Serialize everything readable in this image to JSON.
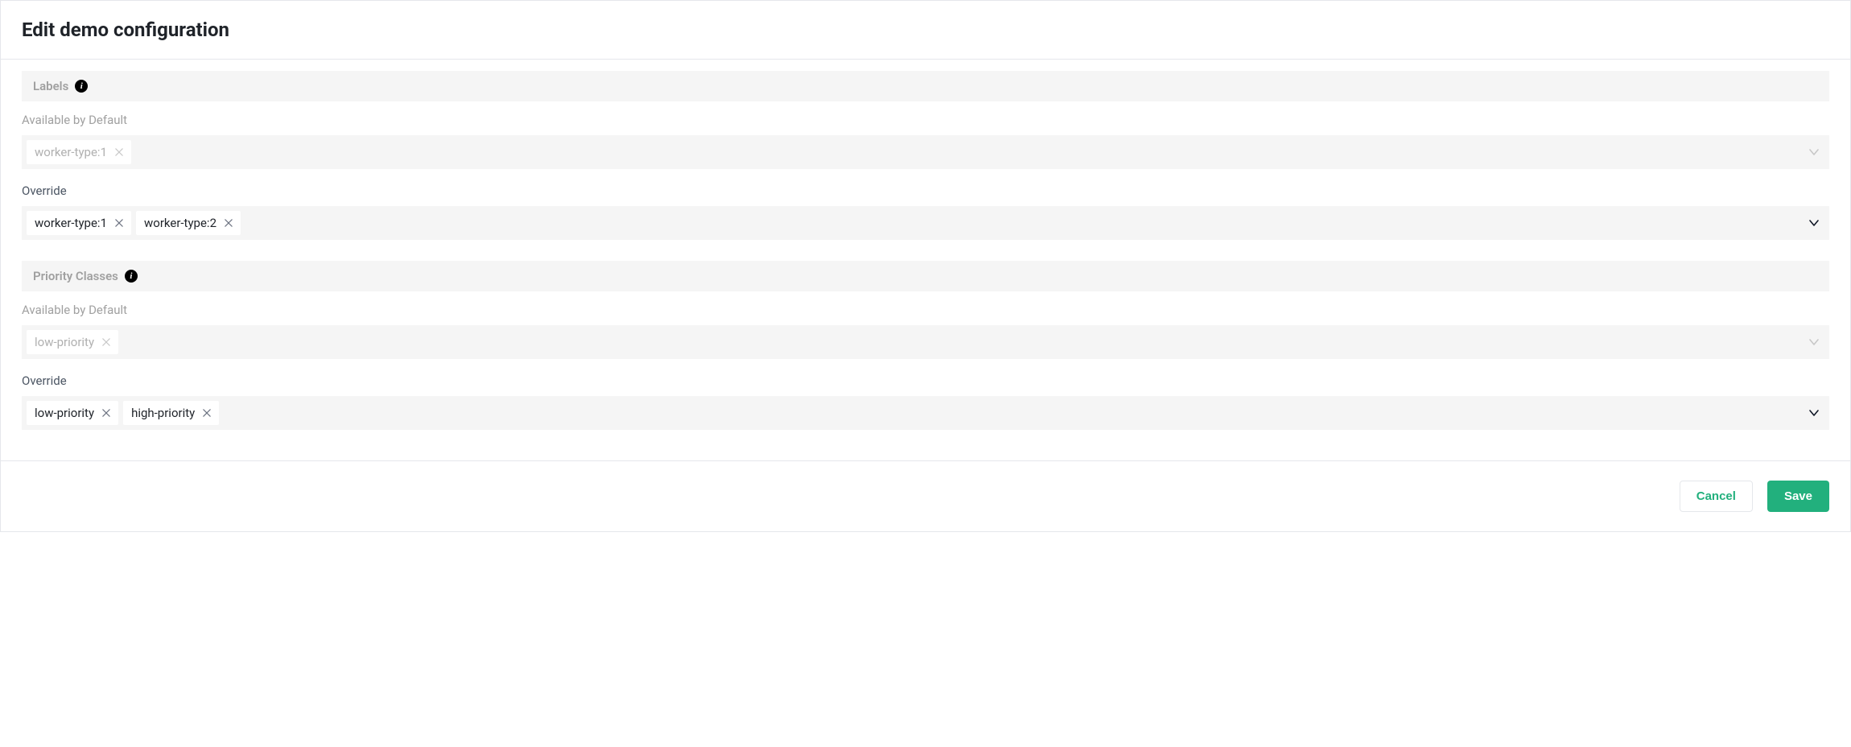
{
  "header": {
    "title": "Edit demo configuration"
  },
  "sections": {
    "labels": {
      "title": "Labels",
      "default_label": "Available by Default",
      "default_tags": [
        "worker-type:1"
      ],
      "override_label": "Override",
      "override_tags": [
        "worker-type:1",
        "worker-type:2"
      ]
    },
    "priority": {
      "title": "Priority Classes",
      "default_label": "Available by Default",
      "default_tags": [
        "low-priority"
      ],
      "override_label": "Override",
      "override_tags": [
        "low-priority",
        "high-priority"
      ]
    }
  },
  "footer": {
    "cancel": "Cancel",
    "save": "Save"
  }
}
